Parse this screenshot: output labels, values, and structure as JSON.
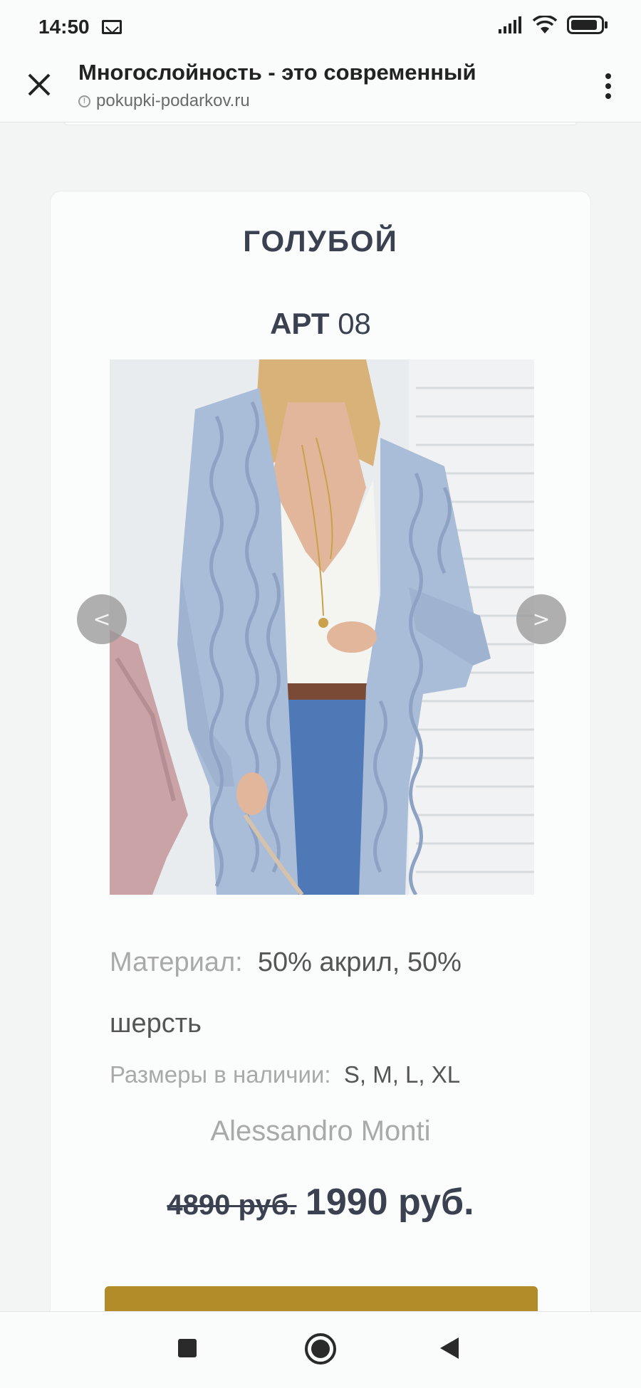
{
  "status_bar": {
    "time": "14:50",
    "icons": [
      "mail-icon",
      "signal-icon",
      "wifi-icon",
      "battery-icon"
    ]
  },
  "browser": {
    "title": "Многослойность - это современный",
    "url": "pokupki-podarkov.ru",
    "icons": [
      "close-icon",
      "info-icon",
      "more-vert-icon"
    ]
  },
  "product": {
    "color_name": "ГОЛУБОЙ",
    "art_label": "АРТ",
    "art_number": "08",
    "image_alt": "голубой вязаный кардиган",
    "prev_arrow": "<",
    "next_arrow": ">",
    "material_label": "Материал:",
    "material_value": "50% акрил, 50% шерсть",
    "sizes_label": "Размеры в наличии:",
    "sizes_value": "S, M, L, XL",
    "brand": "Alessandro Monti",
    "old_price": "4890 руб.",
    "new_price": "1990 руб."
  },
  "colors": {
    "accent_button": "#b38c2a",
    "text_dark": "#3b4150",
    "text_muted": "#a9a9a9",
    "cardigan": "#a9bcd8",
    "page_background": "#f3f5f4"
  },
  "nav_bar": {
    "icons": [
      "recent-apps-icon",
      "home-icon",
      "back-icon"
    ]
  }
}
